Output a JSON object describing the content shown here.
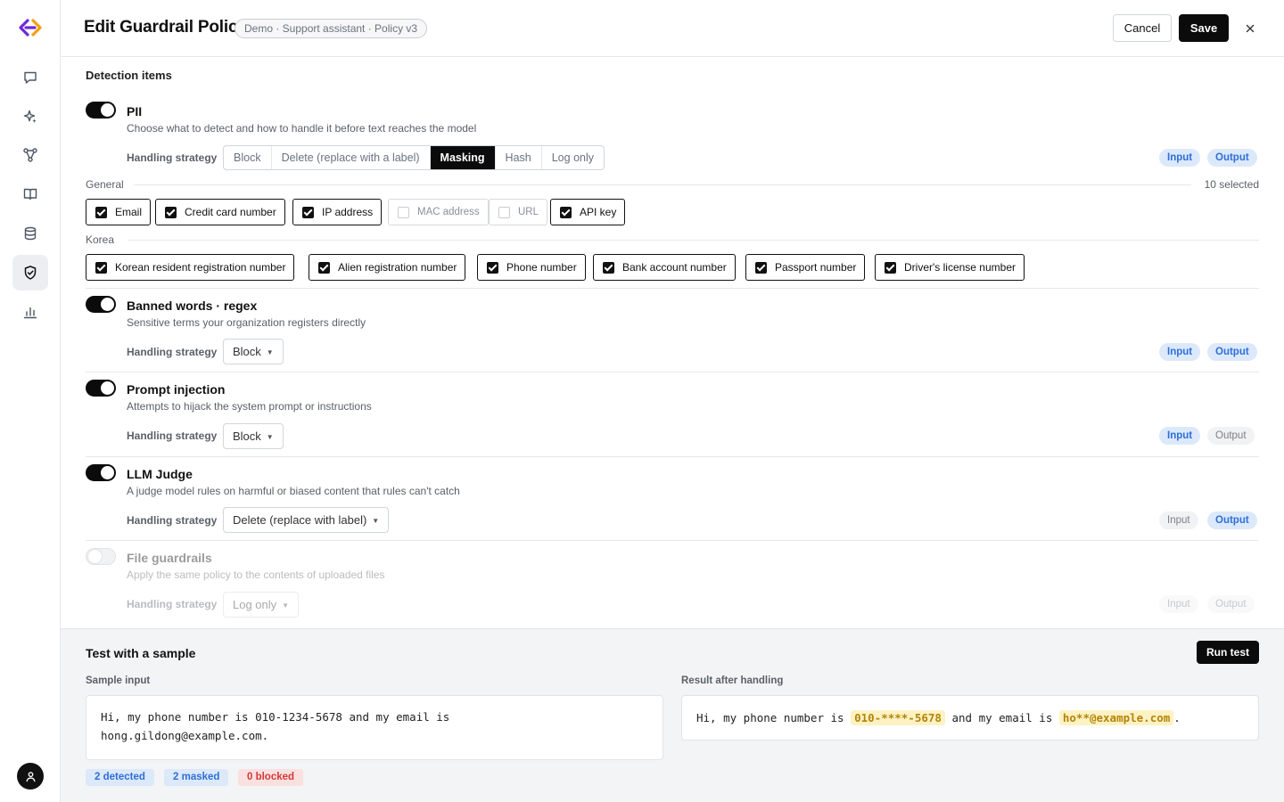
{
  "header": {
    "title": "Edit Guardrail Policy",
    "breadcrumb": "Demo · Support assistant · Policy v3",
    "cancel_label": "Cancel",
    "save_label": "Save"
  },
  "sidebar": {
    "items": [
      "chat-icon",
      "sparkle-icon",
      "workflow-icon",
      "book-icon",
      "database-icon",
      "shield-check-icon",
      "bar-chart-icon"
    ],
    "active": "shield-check-icon"
  },
  "detection": {
    "heading": "Detection items",
    "handling_label": "Handling strategy",
    "input_label": "Input",
    "output_label": "Output",
    "pii": {
      "enabled": true,
      "title": "PII",
      "description": "Choose what to detect and how to handle it before text reaches the model",
      "strategies": [
        "Block",
        "Delete (replace with a label)",
        "Masking",
        "Hash",
        "Log only"
      ],
      "selected_strategy": "Masking",
      "input_on": true,
      "output_on": true,
      "general_label": "General",
      "selected_count": "10 selected",
      "general_items": [
        {
          "label": "Email",
          "checked": true
        },
        {
          "label": "Credit card number",
          "checked": true
        },
        {
          "label": "IP address",
          "checked": true
        },
        {
          "label": "MAC address",
          "checked": false
        },
        {
          "label": "URL",
          "checked": false
        },
        {
          "label": "API key",
          "checked": true
        }
      ],
      "korea_label": "Korea",
      "korea_items": [
        {
          "label": "Korean resident registration number",
          "checked": true
        },
        {
          "label": "Alien registration number",
          "checked": true
        },
        {
          "label": "Phone number",
          "checked": true
        },
        {
          "label": "Bank account number",
          "checked": true
        },
        {
          "label": "Passport number",
          "checked": true
        },
        {
          "label": "Driver's license number",
          "checked": true
        }
      ]
    },
    "banned": {
      "enabled": true,
      "title": "Banned words · regex",
      "description": "Sensitive terms your organization registers directly",
      "strategy": "Block",
      "input_on": true,
      "output_on": true
    },
    "injection": {
      "enabled": true,
      "title": "Prompt injection",
      "description": "Attempts to hijack the system prompt or instructions",
      "strategy": "Block",
      "input_on": true,
      "output_on": false
    },
    "judge": {
      "enabled": true,
      "title": "LLM Judge",
      "description": "A judge model rules on harmful or biased content that rules can't catch",
      "strategy": "Delete (replace with label)",
      "input_on": false,
      "output_on": true
    },
    "files": {
      "enabled": false,
      "title": "File guardrails",
      "description": "Apply the same policy to the contents of uploaded files",
      "strategy": "Log only",
      "input_on": false,
      "output_on": false
    }
  },
  "test": {
    "title": "Test with a sample",
    "run_label": "Run test",
    "input_label": "Sample input",
    "result_label": "Result after handling",
    "input_text": "Hi, my phone number is 010-1234-5678 and my email is\nhong.gildong@example.com.",
    "result_prefix": "Hi, my phone number is ",
    "result_phone": "010-****-5678",
    "result_middle": " and my email is ",
    "result_email": "ho**@example.com",
    "result_suffix": ".",
    "stats": {
      "detected": "2 detected",
      "masked": "2 masked",
      "blocked": "0 blocked"
    }
  },
  "colors": {
    "accent": "#0b0b0c",
    "chip_blue": "#2f6fd6",
    "chip_blue_bg": "#dce9fb",
    "highlight": "#fdf2c4",
    "danger": "#d23b3b"
  }
}
